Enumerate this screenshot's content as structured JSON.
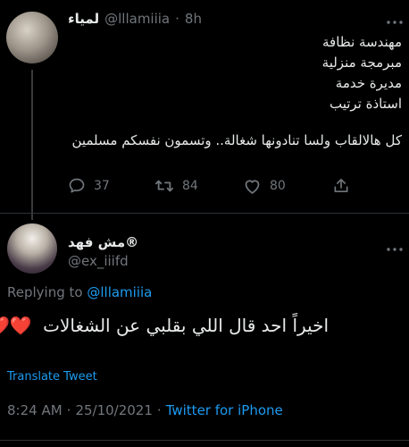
{
  "parent_tweet": {
    "display_name": "لمياء",
    "handle": "@lllamiiia",
    "separator": "·",
    "time": "8h",
    "lines": [
      "مهندسة نظافة",
      "مبرمجة منزلية",
      "مديرة خدمة",
      "استاذة ترتيب"
    ],
    "body": "كل هالالقاب ولسا تنادونها شغالة.. وتسمون نفسكم مسلمين",
    "replies": "37",
    "retweets": "84",
    "likes": "80"
  },
  "reply": {
    "display_name": "مش فهد®",
    "handle": "@ex_iiifd",
    "replying_prefix": "Replying to",
    "replying_handle": "@lllamiiia",
    "text": "اخيراً احد قال اللي بقلبي عن الشغالات",
    "emoji": "❤️❤️",
    "translate": "Translate Tweet",
    "time": "8:24 AM",
    "date": "25/10/2021",
    "separator": "·",
    "source": "Twitter for iPhone"
  },
  "colors": {
    "link": "#1d9bf0",
    "muted": "#71767b",
    "heart": "#e0245e"
  }
}
